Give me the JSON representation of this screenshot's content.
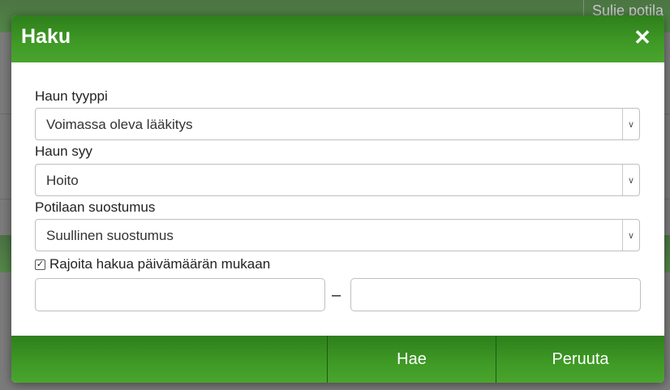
{
  "background": {
    "top_link": "Sulje potila"
  },
  "modal": {
    "title": "Haku",
    "close_icon": "close-icon",
    "fields": {
      "search_type": {
        "label": "Haun tyyppi",
        "value": "Voimassa oleva lääkitys"
      },
      "search_reason": {
        "label": "Haun syy",
        "value": "Hoito"
      },
      "patient_consent": {
        "label": "Potilaan suostumus",
        "value": "Suullinen suostumus"
      }
    },
    "limit_by_date": {
      "label": "Rajoita hakua päivämäärän mukaan",
      "checked": true
    },
    "date_range": {
      "start_value": "",
      "separator": "–",
      "end_value": ""
    },
    "buttons": {
      "search": "Hae",
      "cancel": "Peruuta"
    }
  },
  "colors": {
    "header_green": "#3f9a26",
    "dark_green": "#2e7f1b"
  }
}
